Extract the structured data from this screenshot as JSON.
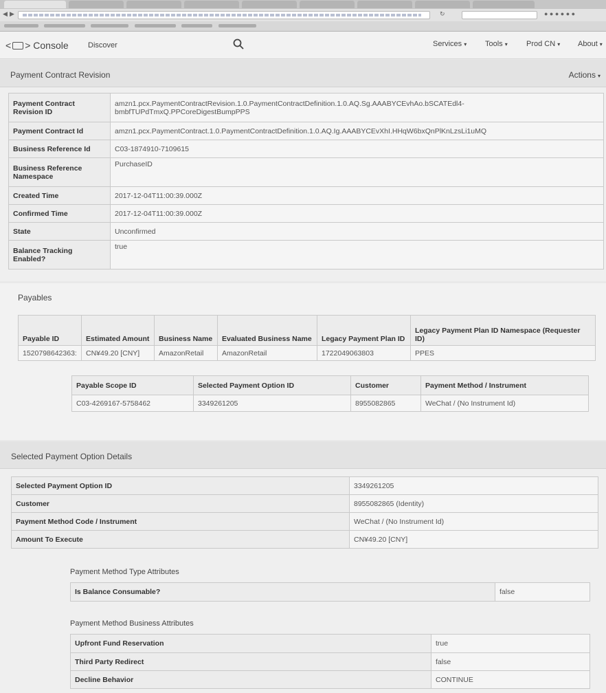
{
  "nav": {
    "brand": "Console",
    "discover": "Discover",
    "services": "Services",
    "tools": "Tools",
    "region": "Prod CN",
    "about": "About"
  },
  "revision": {
    "title": "Payment Contract Revision",
    "actions": "Actions",
    "rows": [
      {
        "key": "Payment Contract Revision ID",
        "value": "amzn1.pcx.PaymentContractRevision.1.0.PaymentContractDefinition.1.0.AQ.Sg.AAABYCEvhAo.bSCATEdl4-bmbfTUPdTmxQ.PPCoreDigestBumpPPS"
      },
      {
        "key": "Payment Contract Id",
        "value": "amzn1.pcx.PaymentContract.1.0.PaymentContractDefinition.1.0.AQ.Ig.AAABYCEvXhI.HHqW6bxQnPlKnLzsLi1uMQ"
      },
      {
        "key": "Business Reference Id",
        "value": "C03-1874910-7109615"
      },
      {
        "key": "Business Reference Namespace",
        "value": "PurchaseID"
      },
      {
        "key": "Created Time",
        "value": "2017-12-04T11:00:39.000Z"
      },
      {
        "key": "Confirmed Time",
        "value": "2017-12-04T11:00:39.000Z"
      },
      {
        "key": "State",
        "value": "Unconfirmed"
      },
      {
        "key": "Balance Tracking Enabled?",
        "value": "true"
      }
    ]
  },
  "payables": {
    "title": "Payables",
    "headers": [
      "Payable ID",
      "Estimated Amount",
      "Business Name",
      "Evaluated Business Name",
      "Legacy Payment Plan ID",
      "Legacy Payment Plan ID Namespace (Requester ID)"
    ],
    "row": [
      "1520798642363:",
      "CN¥49.20 [CNY]",
      "AmazonRetail",
      "AmazonRetail",
      "1722049063803",
      "PPES"
    ],
    "scope_headers": [
      "Payable Scope ID",
      "Selected Payment Option ID",
      "Customer",
      "Payment Method / Instrument"
    ],
    "scope_row": [
      "C03-4269167-5758462",
      "3349261205",
      "8955082865",
      "WeChat / (No Instrument Id)"
    ]
  },
  "spo": {
    "title": "Selected Payment Option Details",
    "rows": [
      {
        "key": "Selected Payment Option ID",
        "value": "3349261205"
      },
      {
        "key": "Customer",
        "value": "8955082865 (Identity)"
      },
      {
        "key": "Payment Method Code / Instrument",
        "value": "WeChat / (No Instrument Id)"
      },
      {
        "key": "Amount To Execute",
        "value": "CN¥49.20 [CNY]"
      }
    ],
    "type_attrs_title": "Payment Method Type Attributes",
    "type_attrs": [
      {
        "key": "Is Balance Consumable?",
        "value": "false"
      }
    ],
    "biz_attrs_title": "Payment Method Business Attributes",
    "biz_attrs": [
      {
        "key": "Upfront Fund Reservation",
        "value": "true"
      },
      {
        "key": "Third Party Redirect",
        "value": "false"
      },
      {
        "key": "Decline Behavior",
        "value": "CONTINUE"
      }
    ]
  }
}
